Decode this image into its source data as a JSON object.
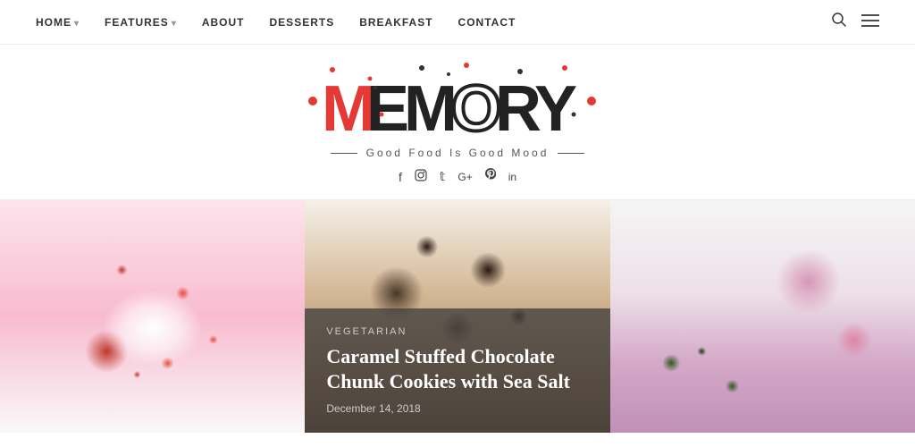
{
  "nav": {
    "links": [
      {
        "id": "home",
        "label": "HOME",
        "hasDropdown": true
      },
      {
        "id": "features",
        "label": "FEATURES",
        "hasDropdown": true
      },
      {
        "id": "about",
        "label": "ABOUT",
        "hasDropdown": false
      },
      {
        "id": "desserts",
        "label": "DESSERTS",
        "hasDropdown": false
      },
      {
        "id": "breakfast",
        "label": "BREAKFAST",
        "hasDropdown": false
      },
      {
        "id": "contact",
        "label": "CONTACT",
        "hasDropdown": false
      }
    ],
    "search_icon": "🔍",
    "menu_icon": "☰"
  },
  "header": {
    "logo_text": "MEMORY",
    "tagline": "Good Food Is Good Mood",
    "social_links": [
      {
        "id": "facebook",
        "label": "f"
      },
      {
        "id": "instagram",
        "label": "◉"
      },
      {
        "id": "twitter",
        "label": "𝕥"
      },
      {
        "id": "googleplus",
        "label": "G+"
      },
      {
        "id": "pinterest",
        "label": "𝓟"
      },
      {
        "id": "linkedin",
        "label": "in"
      }
    ]
  },
  "featured_post": {
    "category": "VEGETARIAN",
    "title": "Caramel Stuffed Chocolate Chunk Cookies with Sea Salt",
    "date": "December 14, 2018"
  }
}
